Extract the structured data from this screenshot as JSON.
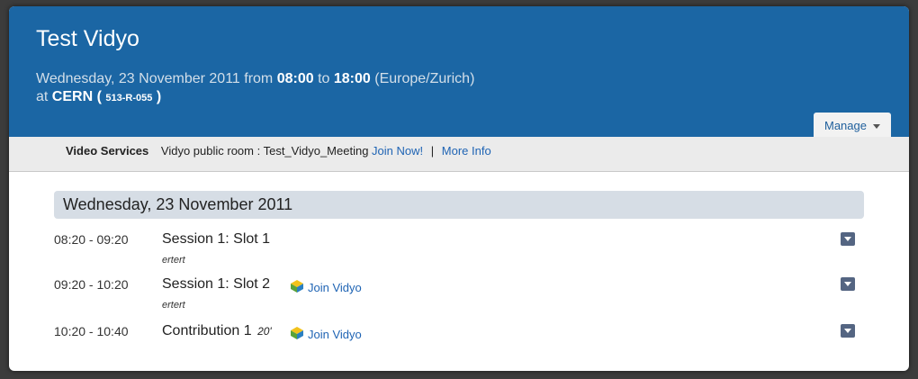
{
  "event": {
    "title": "Test Vidyo",
    "date_text": "Wednesday, 23 November 2011 from",
    "start": "08:00",
    "to_word": "to",
    "end": "18:00",
    "timezone": "(Europe/Zurich)",
    "at_word": "at",
    "location": "CERN",
    "open_paren": "(",
    "room": "513-R-055",
    "close_paren": ")"
  },
  "manage": {
    "label": "Manage"
  },
  "video_services": {
    "label": "Video Services",
    "room_text": "Vidyo public room : Test_Vidyo_Meeting",
    "join_now": "Join Now!",
    "separator": "|",
    "more_info": "More Info"
  },
  "day": {
    "heading": "Wednesday, 23 November 2011"
  },
  "timetable": [
    {
      "time": "08:20 - 09:20",
      "title": "Session 1: Slot 1",
      "subtitle": "ertert",
      "join": ""
    },
    {
      "time": "09:20 - 10:20",
      "title": "Session 1: Slot 2",
      "subtitle": "ertert",
      "join": "Join Vidyo"
    },
    {
      "time": "10:20 - 10:40",
      "title": "Contribution 1",
      "duration": "20'",
      "join": "Join Vidyo"
    }
  ],
  "colors": {
    "header_bg": "#1b66a4",
    "link": "#1f64b4",
    "day_bar": "#d6dde5",
    "menu_button": "#546582"
  },
  "icons": {
    "vidyo": "vidyo-logo-icon",
    "menu": "chevron-down-icon"
  }
}
